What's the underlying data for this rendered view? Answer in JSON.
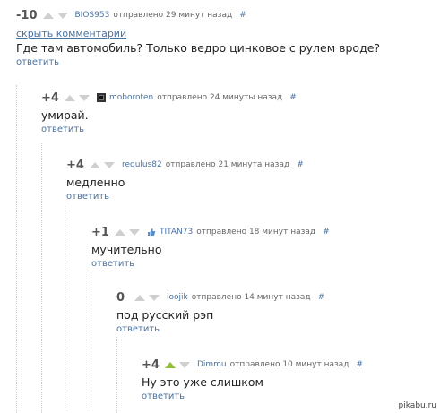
{
  "comments": [
    {
      "rating": "-10",
      "author": "BIOS953",
      "meta": "отправлено 29 минут назад",
      "hash": "#",
      "hide": "скрыть комментарий",
      "text": "Где там автомобиль? Только ведро цинковое с рулем вроде?",
      "reply": "ответить"
    },
    {
      "rating": "+4",
      "author": "moboroten",
      "meta": "отправлено 24 минуты назад",
      "hash": "#",
      "text": "умирай.",
      "reply": "ответить"
    },
    {
      "rating": "+4",
      "author": "regulus82",
      "meta": "отправлено 21 минута назад",
      "hash": "#",
      "text": "медленно",
      "reply": "ответить"
    },
    {
      "rating": "+1",
      "author": "TITAN73",
      "meta": "отправлено 18 минут назад",
      "hash": "#",
      "text": "мучительно",
      "reply": "ответить"
    },
    {
      "rating": "0",
      "author": "ioojik",
      "meta": "отправлено 14 минут назад",
      "hash": "#",
      "text": "под русский рэп",
      "reply": "ответить"
    },
    {
      "rating": "+4",
      "author": "Dimmu",
      "meta": "отправлено 10 минут назад",
      "hash": "#",
      "text": "Ну это уже слишком",
      "reply": "ответить"
    }
  ],
  "watermark": "pikabu.ru",
  "colors": {
    "link": "#4a72a0",
    "upvote_active": "#8fbf3c",
    "arrow": "#cfcfcf"
  }
}
